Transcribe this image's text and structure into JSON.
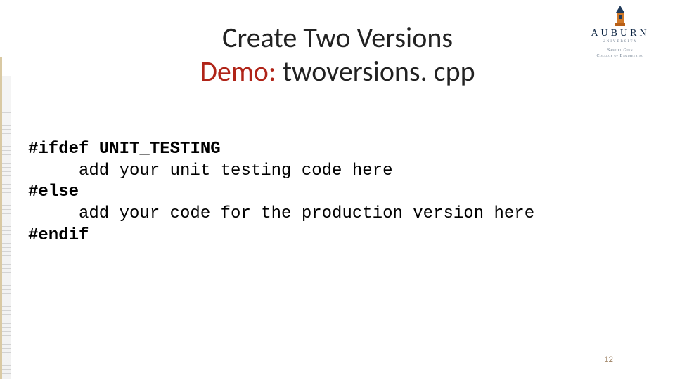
{
  "logo": {
    "wordmark": "AUBURN",
    "subline": "UNIVERSITY",
    "college_line1": "Samuel Ginn",
    "college_line2": "College of Engineering"
  },
  "title": {
    "line1": "Create Two Versions",
    "line2_demo": "Demo:",
    "line2_rest": " twoversions. cpp"
  },
  "code": {
    "l1_kw": "#ifdef UNIT_TESTING",
    "l2": "add your unit testing code here",
    "l3_kw": "#else",
    "l4": "add your code for the production version here",
    "l5_kw": "#endif"
  },
  "page_number": "12"
}
